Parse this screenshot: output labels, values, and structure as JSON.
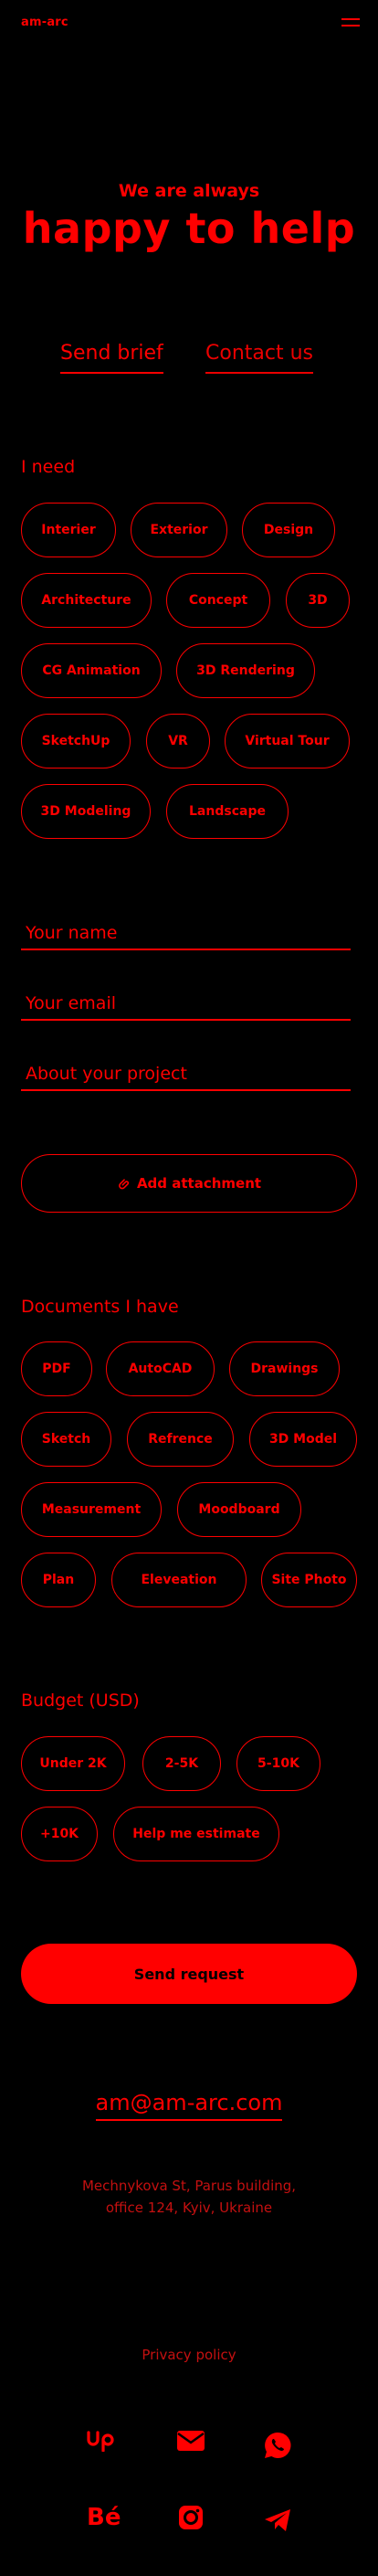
{
  "header": {
    "logo": "am-arc",
    "menu_icon": "hamburger-icon"
  },
  "hero": {
    "line1": "We are always",
    "line2": "happy to help"
  },
  "tabs": [
    {
      "label": "Send brief",
      "active": true
    },
    {
      "label": "Contact us",
      "active": false
    }
  ],
  "need": {
    "title": "I need",
    "options": [
      "Interier",
      "Exterior",
      "Design",
      "Architecture",
      "Concept",
      "3D",
      "CG Animation",
      "3D Rendering",
      "SketchUp",
      "VR",
      "Virtual Tour",
      "3D Modeling",
      "Landscape"
    ]
  },
  "form": {
    "name_placeholder": "Your name",
    "email_placeholder": "Your email",
    "project_placeholder": "About your project",
    "attach_label": "Add attachment",
    "attach_icon": "paperclip-icon"
  },
  "documents": {
    "title": "Documents I have",
    "options": [
      "PDF",
      "AutoCAD",
      "Drawings",
      "Sketch",
      "Refrence",
      "3D Model",
      "Measurement",
      "Moodboard",
      "Plan",
      "Eleveation",
      "Site Photo"
    ]
  },
  "budget": {
    "title": "Budget (USD)",
    "options": [
      "Under 2K",
      "2-5K",
      "5-10K",
      "+10K",
      "Help me estimate"
    ]
  },
  "submit": {
    "label": "Send request"
  },
  "footer": {
    "email": "am@am-arc.com",
    "address_line1": "Mechnykova St, Parus building,",
    "address_line2": "office 124, Kyiv, Ukraine",
    "privacy": "Privacy policy",
    "socials": [
      "upwork-icon",
      "mail-icon",
      "whatsapp-icon",
      "behance-icon",
      "instagram-icon",
      "telegram-icon"
    ]
  },
  "colors": {
    "accent": "#ff0000",
    "background": "#000000",
    "muted": "#c41010"
  }
}
